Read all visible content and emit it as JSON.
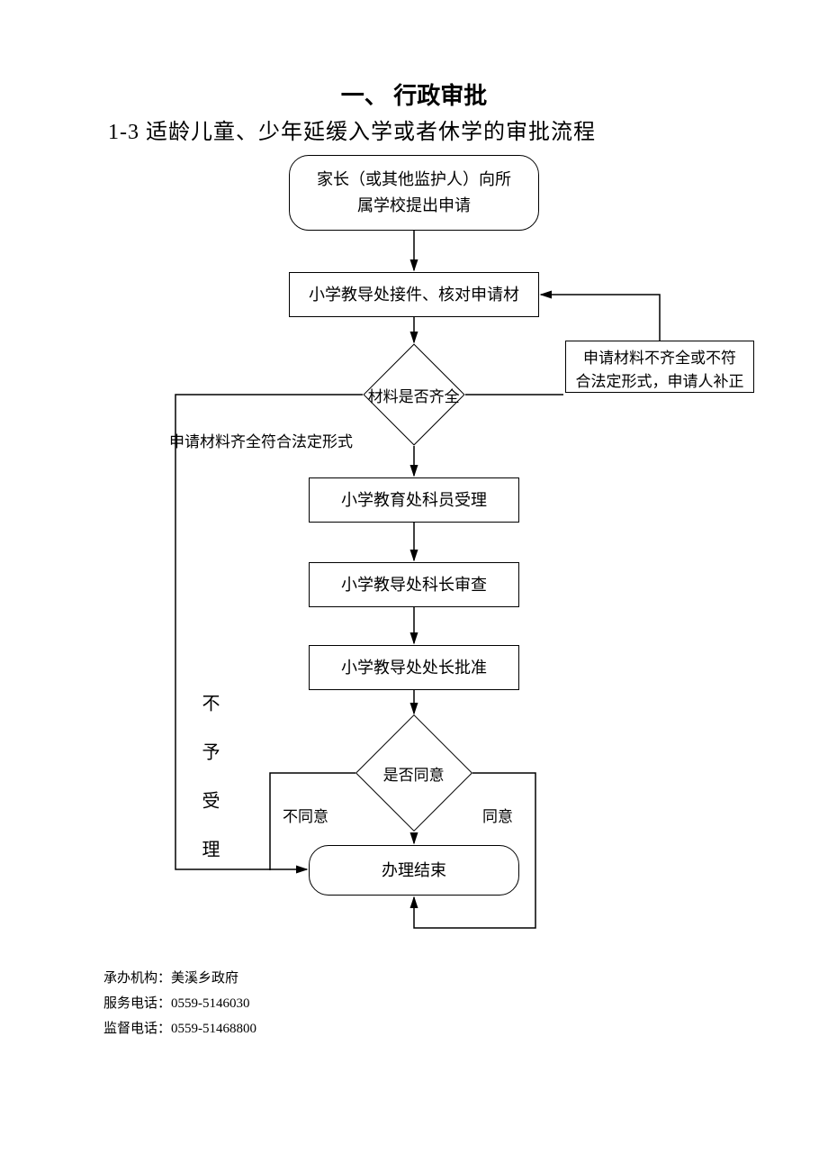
{
  "titles": {
    "main": "一、 行政审批",
    "sub": "1-3 适龄儿童、少年延缓入学或者休学的审批流程"
  },
  "nodes": {
    "start": "家长（或其他监护人）向所\n属学校提出申请",
    "receive": "小学教导处接件、核对申请材",
    "decision1": "材料是否齐全",
    "incomplete": "申请材料不齐全或不符\n合法定形式，申请人补正",
    "complete_label": "申请材料齐全符合法定形式",
    "accept": "小学教育处科员受理",
    "review": "小学教导处科长审查",
    "approve": "小学教导处处长批准",
    "decision2": "是否同意",
    "d2_no": "不同意",
    "d2_yes": "同意",
    "reject_label": "不\n予\n受\n理",
    "end": "办理结束"
  },
  "footer": {
    "org_label": "承办机构：",
    "org_value": "美溪乡政府",
    "svc_label": "服务电话：",
    "svc_value": "0559-5146030",
    "sup_label": "监督电话：",
    "sup_value": "0559-51468800"
  }
}
